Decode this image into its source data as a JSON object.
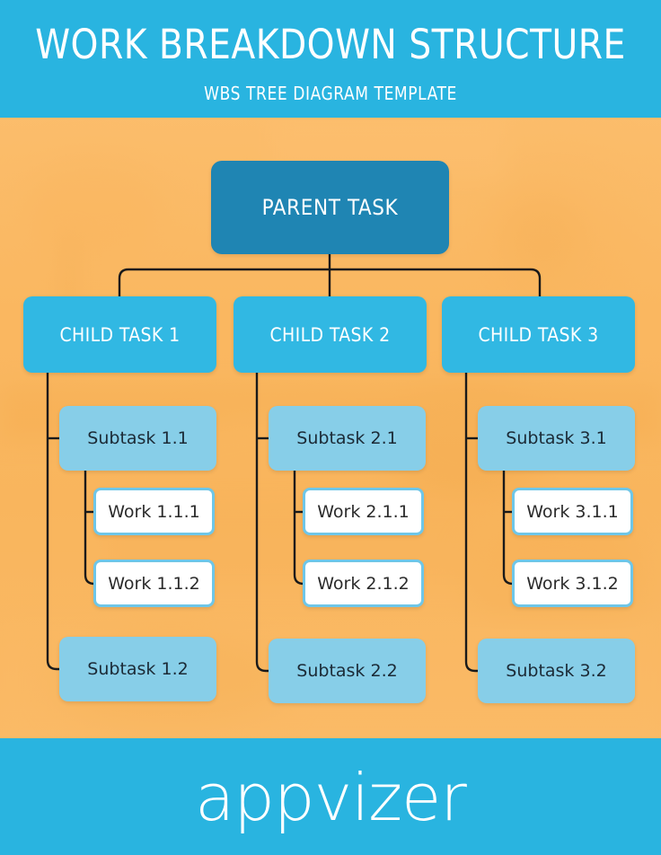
{
  "header": {
    "title": "WORK BREAKDOWN STRUCTURE",
    "subtitle": "WBS TREE DIAGRAM TEMPLATE"
  },
  "footer": {
    "logo": "appvizer"
  },
  "colors": {
    "header_bar": "#29b4e0",
    "footer_bar": "#29b4e0",
    "background": "#fbbd6c",
    "parent_box": "#1f85b3",
    "child_box": "#31b8e3",
    "subtask_box": "#87cee8",
    "work_box_fill": "#ffffff",
    "work_box_border": "#6ec6e8",
    "connector_line": "#1a1a1a"
  },
  "diagram": {
    "type": "tree",
    "root": {
      "label": "PARENT TASK"
    },
    "branches": [
      {
        "label": "CHILD TASK 1",
        "children": [
          {
            "label": "Subtask 1.1",
            "children": [
              {
                "label": "Work 1.1.1"
              },
              {
                "label": "Work 1.1.2"
              }
            ]
          },
          {
            "label": "Subtask 1.2",
            "children": []
          }
        ]
      },
      {
        "label": "CHILD TASK 2",
        "children": [
          {
            "label": "Subtask 2.1",
            "children": [
              {
                "label": "Work 2.1.1"
              },
              {
                "label": "Work 2.1.2"
              }
            ]
          },
          {
            "label": "Subtask 2.2",
            "children": []
          }
        ]
      },
      {
        "label": "CHILD TASK 3",
        "children": [
          {
            "label": "Subtask 3.1",
            "children": [
              {
                "label": "Work 3.1.1"
              },
              {
                "label": "Work 3.1.2"
              }
            ]
          },
          {
            "label": "Subtask 3.2",
            "children": []
          }
        ]
      }
    ]
  }
}
